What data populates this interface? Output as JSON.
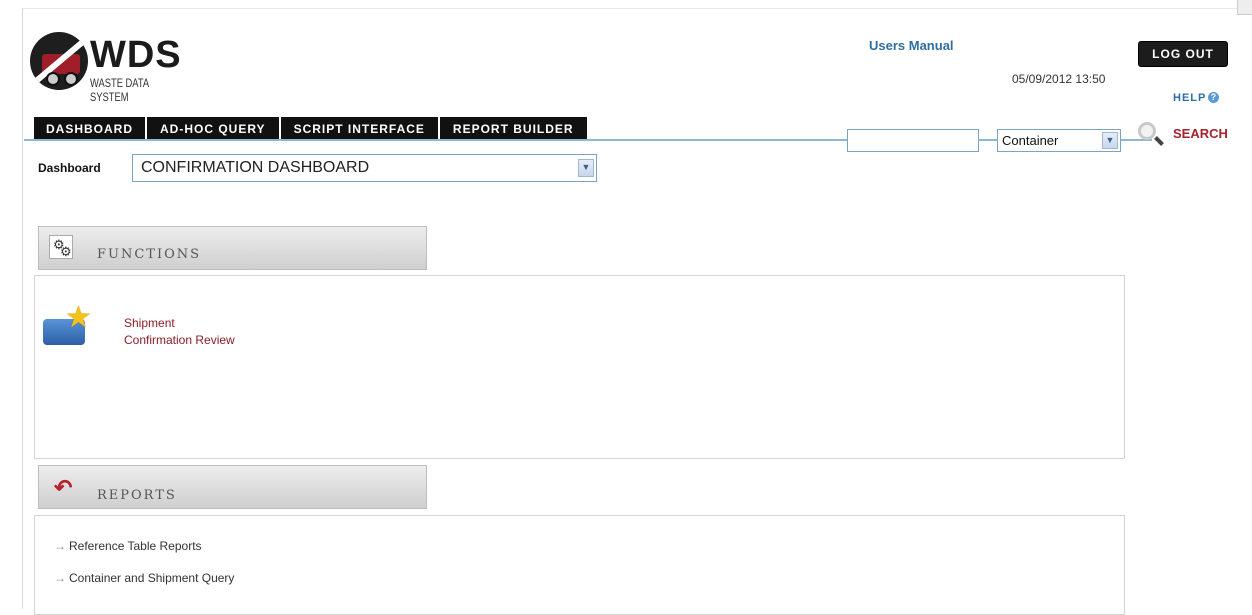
{
  "app": {
    "logo_title": "WDS",
    "logo_subtitle": "WASTE DATA SYSTEM"
  },
  "header": {
    "users_manual": "Users Manual",
    "logout_label": "LOG OUT",
    "datetime": "05/09/2012 13:50",
    "help_label": "HELP",
    "search_label": "SEARCH",
    "search_input_value": "",
    "search_type_selected": "Container"
  },
  "tabs": [
    {
      "label": "DASHBOARD"
    },
    {
      "label": "AD-HOC QUERY"
    },
    {
      "label": "SCRIPT INTERFACE"
    },
    {
      "label": "REPORT BUILDER"
    }
  ],
  "dashboard": {
    "label": "Dashboard",
    "selected": "CONFIRMATION DASHBOARD"
  },
  "functions": {
    "title": "FUNCTIONS",
    "items": [
      {
        "line1": "Shipment",
        "line2": "Confirmation Review"
      }
    ]
  },
  "reports": {
    "title": "REPORTS",
    "items": [
      {
        "label": "Reference Table Reports"
      },
      {
        "label": "Container and Shipment Query"
      }
    ]
  },
  "colors": {
    "accent_blue": "#2f6ea3",
    "link_red": "#8b1c26",
    "search_red": "#a4232e",
    "tab_black": "#111111"
  },
  "icons": {
    "logo": "wds-truck-logo-icon",
    "help": "help-circle-icon",
    "search": "magnifier-icon",
    "functions": "gears-icon",
    "shipment": "truck-star-icon",
    "reports": "back-arrow-icon",
    "dropdown": "chevron-down-icon"
  }
}
